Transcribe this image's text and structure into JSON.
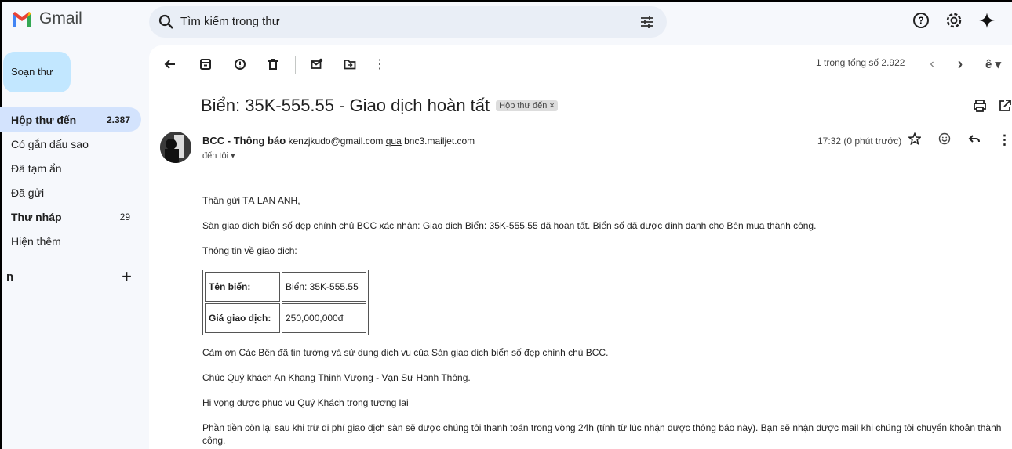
{
  "app": {
    "name": "Gmail"
  },
  "search": {
    "placeholder": "Tìm kiếm trong thư"
  },
  "sidebar": {
    "compose_label": "Soạn thư",
    "items": [
      {
        "label": "Hộp thư đến",
        "count": "2.387"
      },
      {
        "label": "Có gắn dấu sao",
        "count": ""
      },
      {
        "label": "Đã tạm ẩn",
        "count": ""
      },
      {
        "label": "Đã gửi",
        "count": ""
      },
      {
        "label": "Thư nháp",
        "count": "29"
      },
      {
        "label": "Hiện thêm",
        "count": ""
      }
    ],
    "labels_heading": "n"
  },
  "toolbar": {
    "pager": "1 trong tổng số 2.922"
  },
  "message": {
    "subject": "Biển: 35K-555.55 - Giao dịch hoàn tất",
    "inbox_tag": "Hộp thư đến ×",
    "sender_name": "BCC - Thông báo",
    "sender_email": "kenzjkudo@gmail.com",
    "via_word": "qua",
    "via_domain": "bnc3.mailjet.com",
    "to": "đến tôi",
    "time": "17:32 (0 phút trước)",
    "greeting": "Thân gửi TẠ LAN ANH,",
    "para1": "Sàn giao dịch biển số đẹp chính chủ BCC xác nhận: Giao dịch Biển: 35K-555.55 đã hoàn tất. Biển số đã được định danh cho Bên mua thành công.",
    "para2": "Thông tin về giao dịch:",
    "table": [
      {
        "key": "Tên biển:",
        "value": "Biển: 35K-555.55"
      },
      {
        "key": "Giá giao dịch:",
        "value": "250,000,000đ"
      }
    ],
    "para3": "Cảm ơn Các Bên đã tin tưởng và sử dụng dịch vụ của Sàn giao dịch biển số đẹp chính chủ BCC.",
    "para4": "Chúc Quý khách An Khang Thịnh Vượng - Vạn Sự Hanh Thông.",
    "para5": "Hi vọng được phục vụ Quý Khách trong tương lai",
    "para6": "Phần tiền còn lại sau khi trừ đi phí giao dịch sàn sẽ được chúng tôi thanh toán trong vòng 24h (tính từ lúc nhận được thông báo này). Bạn sẽ nhận được mail khi chúng tôi chuyển khoản thành công."
  },
  "colors": {
    "compose_bg": "#c2e7ff",
    "active_nav": "#d3e3fd",
    "search_bg": "#e9eef6",
    "background": "#f6f8fc"
  }
}
